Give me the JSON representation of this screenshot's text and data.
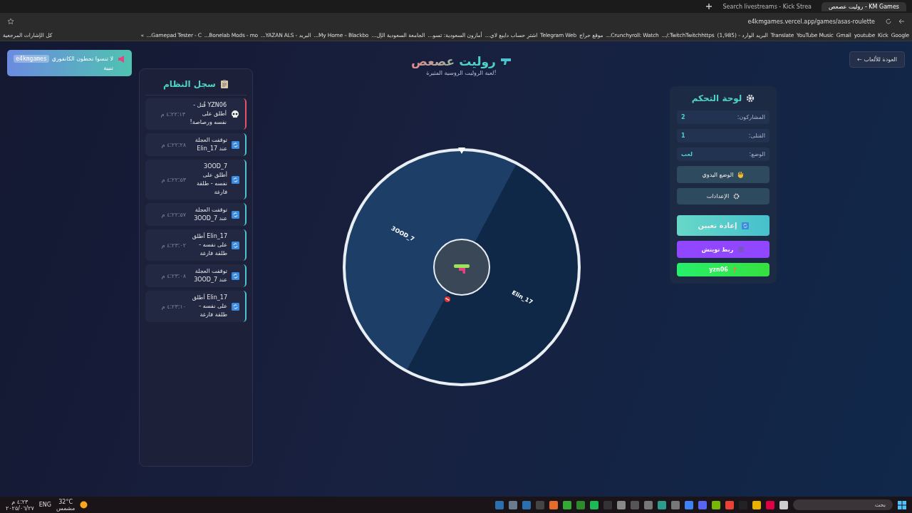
{
  "browser": {
    "tabs": [
      {
        "title": "KM Games - روليت عصعص",
        "selected": true
      },
      {
        "title": "Search livestreams - Kick Strea",
        "selected": false
      }
    ],
    "url": "e4kmgames.vercel.app/games/asas-roulette",
    "bookmarks": [
      "Google",
      "Kick",
      "youtube",
      "Gmail",
      "YouTube Music",
      "Translate",
      "البريد الوارد - (1,985)",
      "TwitchTwitchhttps:/...",
      "Crunchyroll: Watch...",
      "موقع حراج",
      "Telegram Web",
      "اشترِ حساب دايبع لاي...",
      "أمازون السعودية: تسو...",
      "الجامعة السعودية الإل...",
      "My Home – Blackbo...",
      "البريد - YAZAN ALS...",
      "Bonelab Mods - mo...",
      "Gamepad Tester - C..."
    ],
    "more": "»",
    "all_bookmarks": "كل الإشارات المرجعية"
  },
  "notice": {
    "text": "لا تنسوا تحطون الكانفوري",
    "code": "e4kmgames",
    "label": "تنبية"
  },
  "back_button": "← العودة للألعاب",
  "header": {
    "title_main": "روليت",
    "title_accent": "عصعص",
    "subtitle": "لعبة الروليت الروسية المثيرة!"
  },
  "log": {
    "title": "سجل النظام",
    "entries": [
      {
        "kind": "death",
        "text": "YZN06 قُتل - أطلق على نفسه ورصاصة!",
        "time": "٤:٢٢:١٣ م"
      },
      {
        "kind": "spin",
        "text": "توقفت العجلة عند Elin_17",
        "time": "٤:٢٢:٢٨ م"
      },
      {
        "kind": "spin",
        "text": "3OOD_7 أطلق على نفسه - طلقة فارغة",
        "time": "٤:٢٢:٥٣ م"
      },
      {
        "kind": "spin",
        "text": "توقفت العجلة عند 3OOD_7",
        "time": "٤:٢٢:٥٧ م"
      },
      {
        "kind": "spin",
        "text": "Elin_17 أطلق على نفسه - طلقة فارغة",
        "time": "٤:٢٣:٠٢ م"
      },
      {
        "kind": "spin",
        "text": "توقفت العجلة عند 3OOD_7",
        "time": "٤:٢٣:٠٨ م"
      },
      {
        "kind": "spin",
        "text": "Elin_17 أطلق على نفسه - طلقة فارغة",
        "time": "٤:٢٣:١٠ م"
      }
    ]
  },
  "wheel": {
    "segments": [
      {
        "name": "3OOD_7",
        "color": "#1d3e66"
      },
      {
        "name": "Elin_17",
        "color": "#0f2848"
      }
    ]
  },
  "control_panel": {
    "title": "لوحة التحكم",
    "stats": [
      {
        "label": "المشاركون:",
        "value": "2"
      },
      {
        "label": "القتلى:",
        "value": "1"
      },
      {
        "label": "الوضع:",
        "value": "لعب"
      }
    ],
    "buttons": [
      {
        "kind": "secondary",
        "label": "الوضع اليدوي"
      },
      {
        "kind": "secondary",
        "label": "الإعدادات"
      },
      {
        "kind": "primary",
        "label": "إعادة تعيين"
      },
      {
        "kind": "twitch",
        "label": "ربط تويتش"
      },
      {
        "kind": "user",
        "label": "yzn06"
      }
    ]
  },
  "taskbar": {
    "search": "بحث",
    "temperature": "32°C",
    "weather": "مشمس",
    "language": "ENG",
    "time": "٤:٢٣ م",
    "date": "٢٠٢٥/٠٦/٢٧"
  }
}
